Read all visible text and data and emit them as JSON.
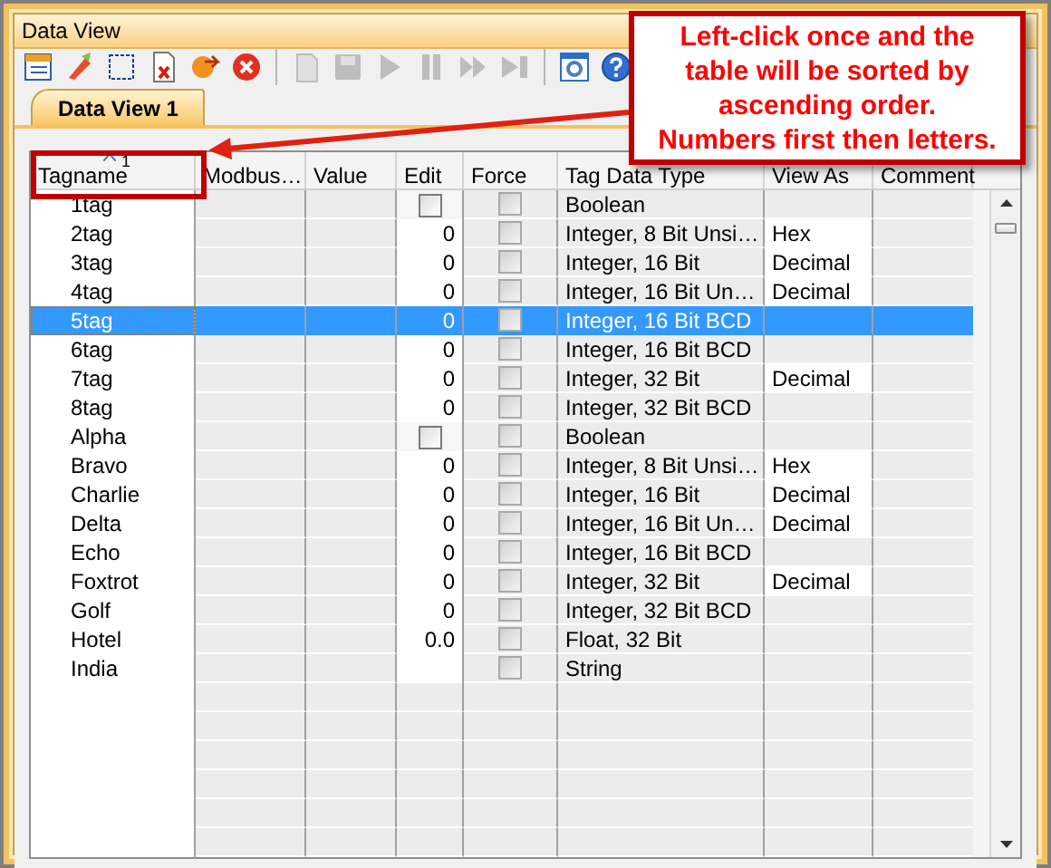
{
  "window": {
    "title": "Data View"
  },
  "toolbar": [
    {
      "kind": "table",
      "disabled": false
    },
    {
      "kind": "pencil",
      "disabled": false
    },
    {
      "kind": "select",
      "disabled": false
    },
    {
      "kind": "doc-delete",
      "disabled": false
    },
    {
      "kind": "arrow",
      "disabled": false
    },
    {
      "kind": "cancel",
      "disabled": false
    },
    {
      "kind": "sep"
    },
    {
      "kind": "document",
      "disabled": true
    },
    {
      "kind": "save",
      "disabled": true
    },
    {
      "kind": "play",
      "disabled": true
    },
    {
      "kind": "pause",
      "disabled": true
    },
    {
      "kind": "forward",
      "disabled": true
    },
    {
      "kind": "end",
      "disabled": true
    },
    {
      "kind": "sep"
    },
    {
      "kind": "settings",
      "disabled": false
    },
    {
      "kind": "help",
      "disabled": false
    }
  ],
  "tabs": [
    {
      "label": "Data View 1",
      "selected": true
    }
  ],
  "table": {
    "columns": [
      {
        "label": "Tagname",
        "sort_ascending": true,
        "sort_rank": "1"
      },
      {
        "label": "Modbus…"
      },
      {
        "label": "Value"
      },
      {
        "label": "Edit"
      },
      {
        "label": "Force"
      },
      {
        "label": "Tag Data Type"
      },
      {
        "label": "View As"
      },
      {
        "label": "Comment"
      }
    ],
    "rows": [
      {
        "tagname": "1tag",
        "edit": {
          "kind": "checkbox",
          "checked": false
        },
        "force": {
          "checked": false,
          "disabled": true
        },
        "type": "Boolean",
        "selected": false
      },
      {
        "tagname": "2tag",
        "edit": {
          "kind": "text",
          "value": "0"
        },
        "force": {
          "checked": false,
          "disabled": true
        },
        "type": "Integer, 8 Bit Unsi…",
        "view_as": "Hex",
        "selected": false
      },
      {
        "tagname": "3tag",
        "edit": {
          "kind": "text",
          "value": "0"
        },
        "force": {
          "checked": false,
          "disabled": true
        },
        "type": "Integer, 16 Bit",
        "view_as": "Decimal",
        "selected": false
      },
      {
        "tagname": "4tag",
        "edit": {
          "kind": "text",
          "value": "0"
        },
        "force": {
          "checked": false,
          "disabled": true
        },
        "type": "Integer, 16 Bit Un…",
        "view_as": "Decimal",
        "selected": false
      },
      {
        "tagname": "5tag",
        "edit": {
          "kind": "text",
          "value": "0"
        },
        "force": {
          "checked": false,
          "disabled": true
        },
        "type": "Integer, 16 Bit BCD",
        "selected": true
      },
      {
        "tagname": "6tag",
        "edit": {
          "kind": "text",
          "value": "0"
        },
        "force": {
          "checked": false,
          "disabled": true
        },
        "type": "Integer, 16 Bit BCD",
        "selected": false
      },
      {
        "tagname": "7tag",
        "edit": {
          "kind": "text",
          "value": "0"
        },
        "force": {
          "checked": false,
          "disabled": true
        },
        "type": "Integer, 32 Bit",
        "view_as": "Decimal",
        "selected": false
      },
      {
        "tagname": "8tag",
        "edit": {
          "kind": "text",
          "value": "0"
        },
        "force": {
          "checked": false,
          "disabled": true
        },
        "type": "Integer, 32 Bit BCD",
        "selected": false
      },
      {
        "tagname": "Alpha",
        "edit": {
          "kind": "checkbox",
          "checked": false
        },
        "force": {
          "checked": false,
          "disabled": true
        },
        "type": "Boolean",
        "selected": false
      },
      {
        "tagname": "Bravo",
        "edit": {
          "kind": "text",
          "value": "0"
        },
        "force": {
          "checked": false,
          "disabled": true
        },
        "type": "Integer, 8 Bit Unsi…",
        "view_as": "Hex",
        "selected": false
      },
      {
        "tagname": "Charlie",
        "edit": {
          "kind": "text",
          "value": "0"
        },
        "force": {
          "checked": false,
          "disabled": true
        },
        "type": "Integer, 16 Bit",
        "view_as": "Decimal",
        "selected": false
      },
      {
        "tagname": "Delta",
        "edit": {
          "kind": "text",
          "value": "0"
        },
        "force": {
          "checked": false,
          "disabled": true
        },
        "type": "Integer, 16 Bit Un…",
        "view_as": "Decimal",
        "selected": false
      },
      {
        "tagname": "Echo",
        "edit": {
          "kind": "text",
          "value": "0"
        },
        "force": {
          "checked": false,
          "disabled": true
        },
        "type": "Integer, 16 Bit BCD",
        "selected": false
      },
      {
        "tagname": "Foxtrot",
        "edit": {
          "kind": "text",
          "value": "0"
        },
        "force": {
          "checked": false,
          "disabled": true
        },
        "type": "Integer, 32 Bit",
        "view_as": "Decimal",
        "selected": false
      },
      {
        "tagname": "Golf",
        "edit": {
          "kind": "text",
          "value": "0"
        },
        "force": {
          "checked": false,
          "disabled": true
        },
        "type": "Integer, 32 Bit BCD",
        "selected": false
      },
      {
        "tagname": "Hotel",
        "edit": {
          "kind": "text",
          "value": "0.0"
        },
        "force": {
          "checked": false,
          "disabled": true
        },
        "type": "Float, 32 Bit",
        "selected": false
      },
      {
        "tagname": "India",
        "edit": {
          "kind": "blank"
        },
        "force": {
          "checked": false,
          "disabled": true
        },
        "type": "String",
        "selected": false
      }
    ]
  },
  "callout": {
    "text": "Left-click once and the\ntable will be sorted by\nascending order.\nNumbers first then letters."
  }
}
